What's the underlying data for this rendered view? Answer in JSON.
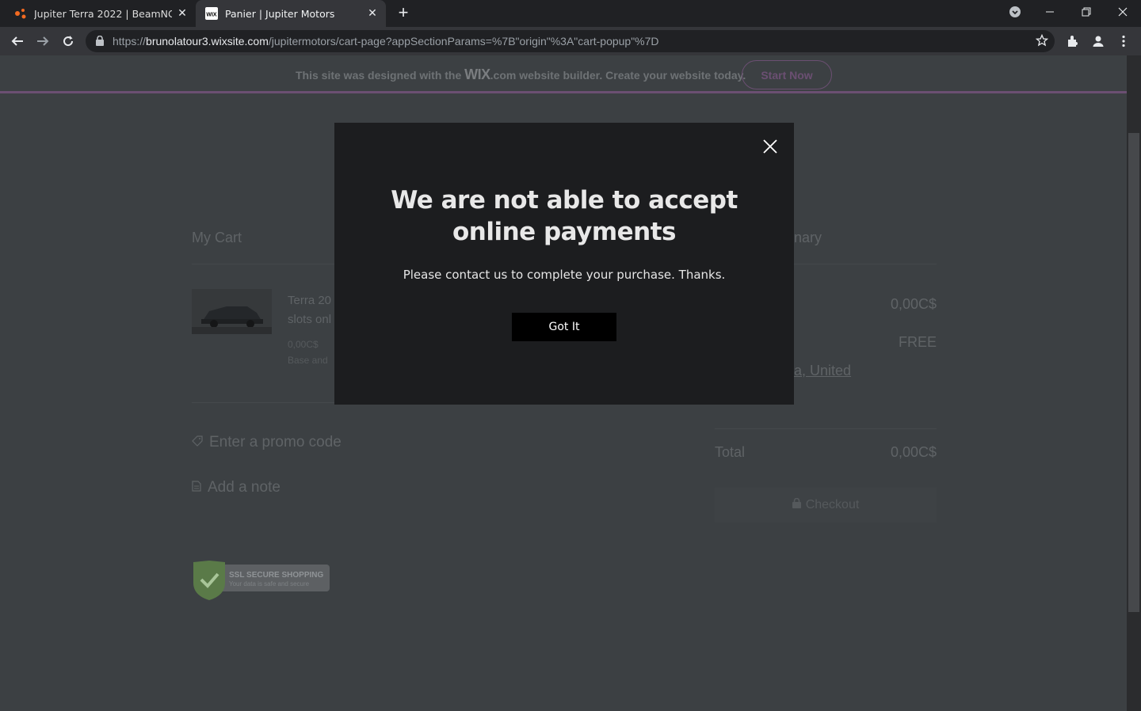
{
  "browser": {
    "tabs": [
      {
        "title": "Jupiter Terra 2022 | BeamNG",
        "favicon": "beamng-icon"
      },
      {
        "title": "Panier | Jupiter Motors",
        "favicon": "wix-icon"
      }
    ],
    "url_prefix": "https://",
    "url_host": "brunolatour3.wixsite.com",
    "url_path": "/jupitermotors/cart-page?appSectionParams=%7B\"origin\"%3A\"cart-popup\"%7D"
  },
  "wix_banner": {
    "text_before": "This site was designed with the ",
    "logo": "WIX",
    "text_after": ".com website builder. Create your website today.",
    "cta": "Start Now"
  },
  "cart": {
    "title": "My Cart",
    "item": {
      "name_line1": "Terra 20",
      "name_line2": "slots onl",
      "price": "0,00C$",
      "option": "Base and"
    },
    "promo_label": "Enter a promo code",
    "note_label": "Add a note",
    "ssl": {
      "title": "SSL SECURE SHOPPING",
      "subtitle": "Your data is safe and secure"
    }
  },
  "summary": {
    "title": "nary",
    "subtotal": "0,00C$",
    "shipping": "FREE",
    "location": "a, United",
    "total_label": "Total",
    "total_value": "0,00C$",
    "checkout_label": "Checkout"
  },
  "modal": {
    "title_line1": "We are not able to accept",
    "title_line2": "online payments",
    "body": "Please contact us to complete your purchase. Thanks.",
    "button": "Got It"
  }
}
